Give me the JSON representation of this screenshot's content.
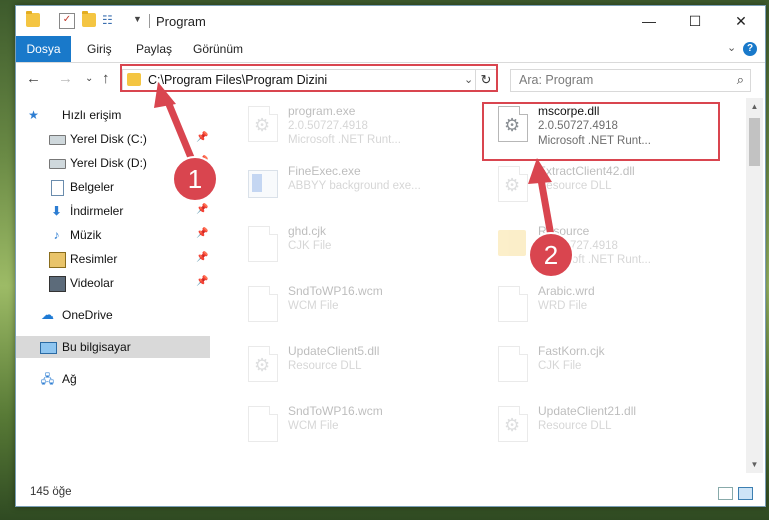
{
  "window": {
    "title": "Program",
    "controls": {
      "minimize": "—",
      "maximize": "☐",
      "close": "✕"
    }
  },
  "ribbon": {
    "tabs": [
      "Dosya",
      "Giriş",
      "Paylaş",
      "Görünüm"
    ],
    "expand": "⌄",
    "help": "?"
  },
  "address": {
    "path": "C:\\Program Files\\Program Dizini",
    "dropdown": "⌄",
    "refresh": "↻"
  },
  "search": {
    "placeholder": "Ara: Program",
    "icon": "⌕"
  },
  "nav": {
    "back": "←",
    "forward": "→",
    "recent": "⌄",
    "up": "↑"
  },
  "sidebar": {
    "items": [
      {
        "label": "Hızlı erişim",
        "icon": "star-icon",
        "pinned": false
      },
      {
        "label": "Yerel Disk (C:)",
        "icon": "disk-icon",
        "pinned": true
      },
      {
        "label": "Yerel Disk (D:)",
        "icon": "disk-icon",
        "pinned": true
      },
      {
        "label": "Belgeler",
        "icon": "documents-icon",
        "pinned": true
      },
      {
        "label": "İndirmeler",
        "icon": "downloads-icon",
        "pinned": true
      },
      {
        "label": "Müzik",
        "icon": "music-icon",
        "pinned": true
      },
      {
        "label": "Resimler",
        "icon": "pictures-icon",
        "pinned": true
      },
      {
        "label": "Videolar",
        "icon": "videos-icon",
        "pinned": true
      },
      {
        "label": "OneDrive",
        "icon": "cloud-icon",
        "pinned": false
      },
      {
        "label": "Bu bilgisayar",
        "icon": "computer-icon",
        "pinned": false,
        "selected": true
      },
      {
        "label": "Ağ",
        "icon": "network-icon",
        "pinned": false
      }
    ]
  },
  "files": [
    {
      "name": "program.exe",
      "line2": "2.0.50727.4918",
      "line3": "Microsoft .NET Runt...",
      "icon": "gear"
    },
    {
      "name": "mscorpe.dll",
      "line2": "2.0.50727.4918",
      "line3": "Microsoft .NET Runt...",
      "icon": "gear",
      "highlighted": true
    },
    {
      "name": "FineExec.exe",
      "line2": "ABBYY background exe...",
      "line3": "",
      "icon": "app"
    },
    {
      "name": "ExtractClient42.dll",
      "line2": "Resource DLL",
      "line3": "",
      "icon": "gear"
    },
    {
      "name": "ghd.cjk",
      "line2": "CJK File",
      "line3": "",
      "icon": "page"
    },
    {
      "name": "Resource",
      "line2": "2.0.50727.4918",
      "line3": "Microsoft .NET Runt...",
      "icon": "folder"
    },
    {
      "name": "SndToWP16.wcm",
      "line2": "WCM File",
      "line3": "",
      "icon": "page"
    },
    {
      "name": "Arabic.wrd",
      "line2": "WRD File",
      "line3": "",
      "icon": "page"
    },
    {
      "name": "UpdateClient5.dll",
      "line2": "Resource DLL",
      "line3": "",
      "icon": "gear"
    },
    {
      "name": "FastKorn.cjk",
      "line2": "CJK File",
      "line3": "",
      "icon": "page"
    },
    {
      "name": "SndToWP16.wcm",
      "line2": "WCM File",
      "line3": "",
      "icon": "page"
    },
    {
      "name": "UpdateClient21.dll",
      "line2": "Resource DLL",
      "line3": "",
      "icon": "gear"
    }
  ],
  "status": {
    "count": "145 öğe"
  },
  "annotations": {
    "badge1": "1",
    "badge2": "2",
    "color": "#d9454f"
  }
}
